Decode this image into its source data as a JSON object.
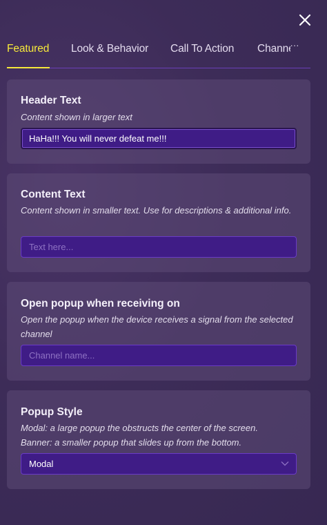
{
  "tabs": [
    {
      "label": "Featured"
    },
    {
      "label": "Look & Behavior"
    },
    {
      "label": "Call To Action"
    },
    {
      "label": "Channels"
    }
  ],
  "more_label": "···",
  "cards": {
    "header_text": {
      "title": "Header Text",
      "description": "Content shown in larger text",
      "value": "HaHa!!! You will never defeat me!!!"
    },
    "content_text": {
      "title": "Content Text",
      "description": "Content shown in smaller text. Use for descriptions & additional info.",
      "placeholder": "Text here..."
    },
    "open_popup": {
      "title": "Open popup when receiving on",
      "description": "Open the popup when the device receives a signal from the selected channel",
      "placeholder": "Channel name..."
    },
    "popup_style": {
      "title": "Popup Style",
      "description_line1": "Modal: a large popup the obstructs the center of the screen.",
      "description_line2": "Banner: a smaller popup that slides up from the bottom.",
      "selected": "Modal"
    }
  },
  "colors": {
    "accent_active_tab": "#f7e93a",
    "field_background": "#3f1c86",
    "panel_background": "#3d2c58"
  },
  "icons": {
    "close": "close-icon",
    "more": "more-icon",
    "dropdown": "chevron-down-icon"
  }
}
